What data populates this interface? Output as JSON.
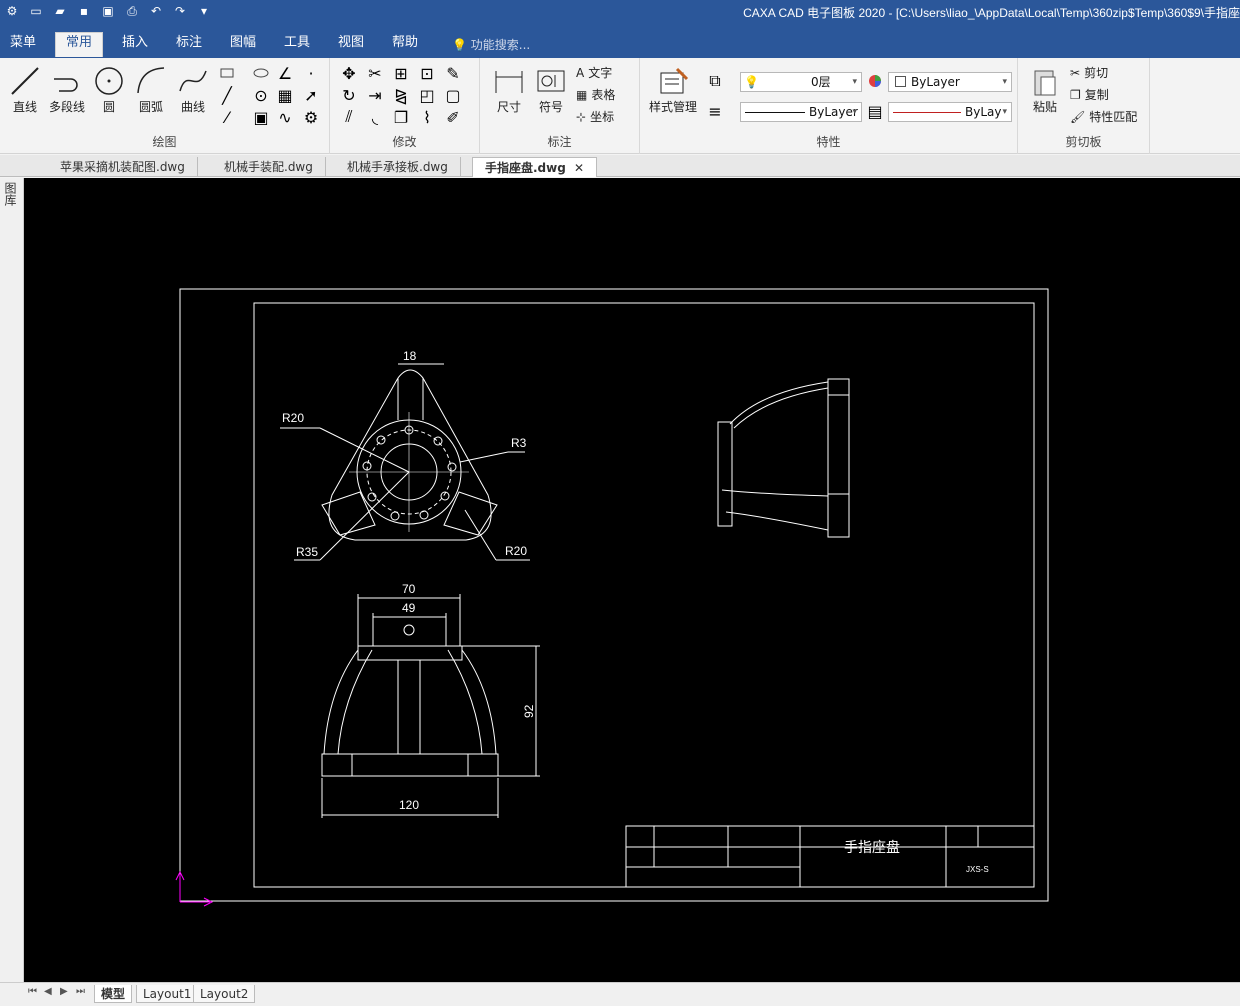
{
  "window": {
    "title": "CAXA CAD 电子图板 2020 - [C:\\Users\\liao_\\AppData\\Local\\Temp\\360zip$Temp\\360$9\\手指座"
  },
  "menu": {
    "file": "菜单",
    "tabs": [
      "常用",
      "插入",
      "标注",
      "图幅",
      "工具",
      "视图",
      "帮助"
    ],
    "search": "功能搜索..."
  },
  "ribbon": {
    "draw": {
      "label": "绘图",
      "line": "直线",
      "polyline": "多段线",
      "circle": "圆",
      "arc": "圆弧",
      "curve": "曲线"
    },
    "modify": {
      "label": "修改"
    },
    "annotate": {
      "label": "标注",
      "dimension": "尺寸",
      "symbol": "符号",
      "text": "文字",
      "table": "表格",
      "coord": "坐标"
    },
    "props": {
      "label": "特性",
      "style": "样式管理",
      "layer": "0层",
      "color": "ByLayer",
      "linetype": "ByLayer",
      "lineweight": "ByLay"
    },
    "clipboard": {
      "label": "剪切板",
      "paste": "粘贴",
      "cut": "剪切",
      "copy": "复制",
      "match": "特性匹配"
    }
  },
  "doc_tabs": [
    "苹果采摘机装配图.dwg",
    "机械手装配.dwg",
    "机械手承接板.dwg",
    "手指座盘.dwg"
  ],
  "left_panel": "图库",
  "drawing": {
    "dims": {
      "d18": "18",
      "r20a": "R20",
      "r3": "R3",
      "r35": "R35",
      "r20b": "R20",
      "d70": "70",
      "d49": "49",
      "d92": "92",
      "d120": "120"
    },
    "title_block": {
      "name": "手指座盘",
      "code": "JXS-S"
    }
  },
  "layout_tabs": [
    "模型",
    "Layout1",
    "Layout2"
  ],
  "colors": {
    "accent": "#2b579a",
    "canvas": "#000000",
    "line": "#ffffff",
    "ucs": "#ff00ff"
  }
}
